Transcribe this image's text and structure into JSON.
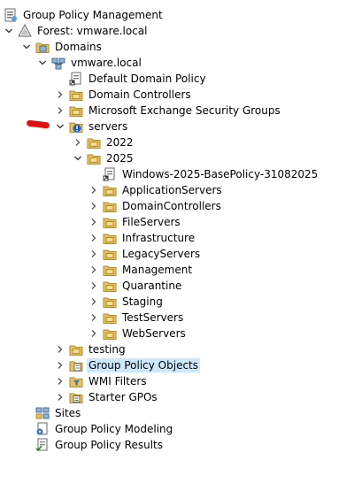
{
  "tree": {
    "root": {
      "label": "Group Policy Management",
      "icon": "gpm-root-icon"
    },
    "forest": {
      "label": "Forest: vmware.local",
      "icon": "forest-icon"
    },
    "domains": {
      "label": "Domains",
      "icon": "domains-folder-icon"
    },
    "domain": {
      "label": "vmware.local",
      "icon": "domain-icon"
    },
    "default_policy": {
      "label": "Default Domain Policy",
      "icon": "gpo-link-icon"
    },
    "domain_controllers": {
      "label": "Domain Controllers",
      "icon": "ou-folder-icon"
    },
    "exchange_groups": {
      "label": "Microsoft Exchange Security Groups",
      "icon": "ou-folder-icon"
    },
    "servers": {
      "label": "servers",
      "icon": "ou-folder-blocked-icon"
    },
    "ou_2022": {
      "label": "2022",
      "icon": "ou-folder-icon"
    },
    "ou_2025": {
      "label": "2025",
      "icon": "ou-folder-icon"
    },
    "basepolicy": {
      "label": "Windows-2025-BasePolicy-31082025",
      "icon": "gpo-link-icon"
    },
    "children_2025": [
      {
        "label": "ApplicationServers"
      },
      {
        "label": "DomainControllers"
      },
      {
        "label": "FileServers"
      },
      {
        "label": "Infrastructure"
      },
      {
        "label": "LegacyServers"
      },
      {
        "label": "Management"
      },
      {
        "label": "Quarantine"
      },
      {
        "label": "Staging"
      },
      {
        "label": "TestServers"
      },
      {
        "label": "WebServers"
      }
    ],
    "testing": {
      "label": "testing",
      "icon": "ou-folder-icon"
    },
    "gpo_objects": {
      "label": "Group Policy Objects",
      "icon": "gpo-container-icon"
    },
    "wmi_filters": {
      "label": "WMI Filters",
      "icon": "wmi-filter-icon"
    },
    "starter_gpos": {
      "label": "Starter GPOs",
      "icon": "starter-gpo-icon"
    },
    "sites": {
      "label": "Sites",
      "icon": "sites-icon"
    },
    "modeling": {
      "label": "Group Policy Modeling",
      "icon": "modeling-icon"
    },
    "results": {
      "label": "Group Policy Results",
      "icon": "results-icon"
    }
  },
  "colors": {
    "selection": "#cce8ff",
    "folder": "#e8c25a",
    "annotation": "#e01010"
  }
}
